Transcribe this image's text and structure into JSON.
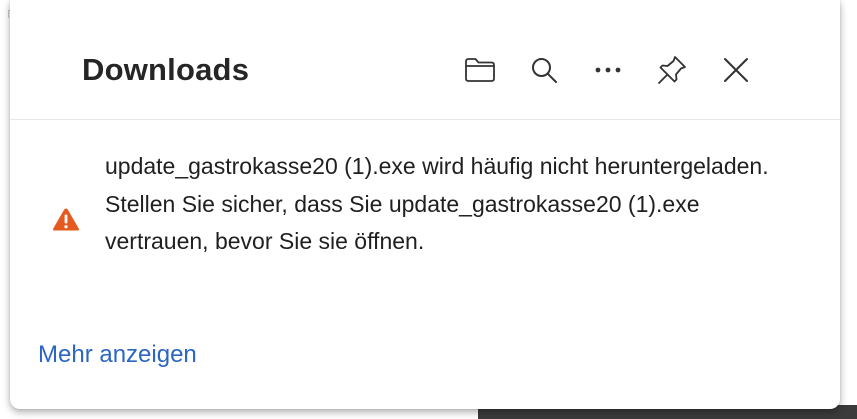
{
  "panel": {
    "title": "Downloads",
    "toolbar": [
      {
        "icon": "folder-icon",
        "action": "open-downloads-folder"
      },
      {
        "icon": "search-icon",
        "action": "search-downloads"
      },
      {
        "icon": "more-options-icon",
        "action": "more-options"
      },
      {
        "icon": "pin-icon",
        "action": "pin-panel"
      },
      {
        "icon": "close-icon",
        "action": "close-panel"
      }
    ]
  },
  "warning": {
    "icon": "warning-triangle-icon",
    "message": "update_gastrokasse20 (1).exe wird häufig nicht heruntergeladen. Stellen Sie sicher, dass Sie update_gastrokasse20 (1).exe vertrauen, bevor Sie sie öffnen.",
    "link": "Mehr anzeigen"
  },
  "colors": {
    "warning_icon": "#e55b1f",
    "link": "#2b66c4",
    "text": "#202020",
    "icon_stroke": "#333333"
  }
}
